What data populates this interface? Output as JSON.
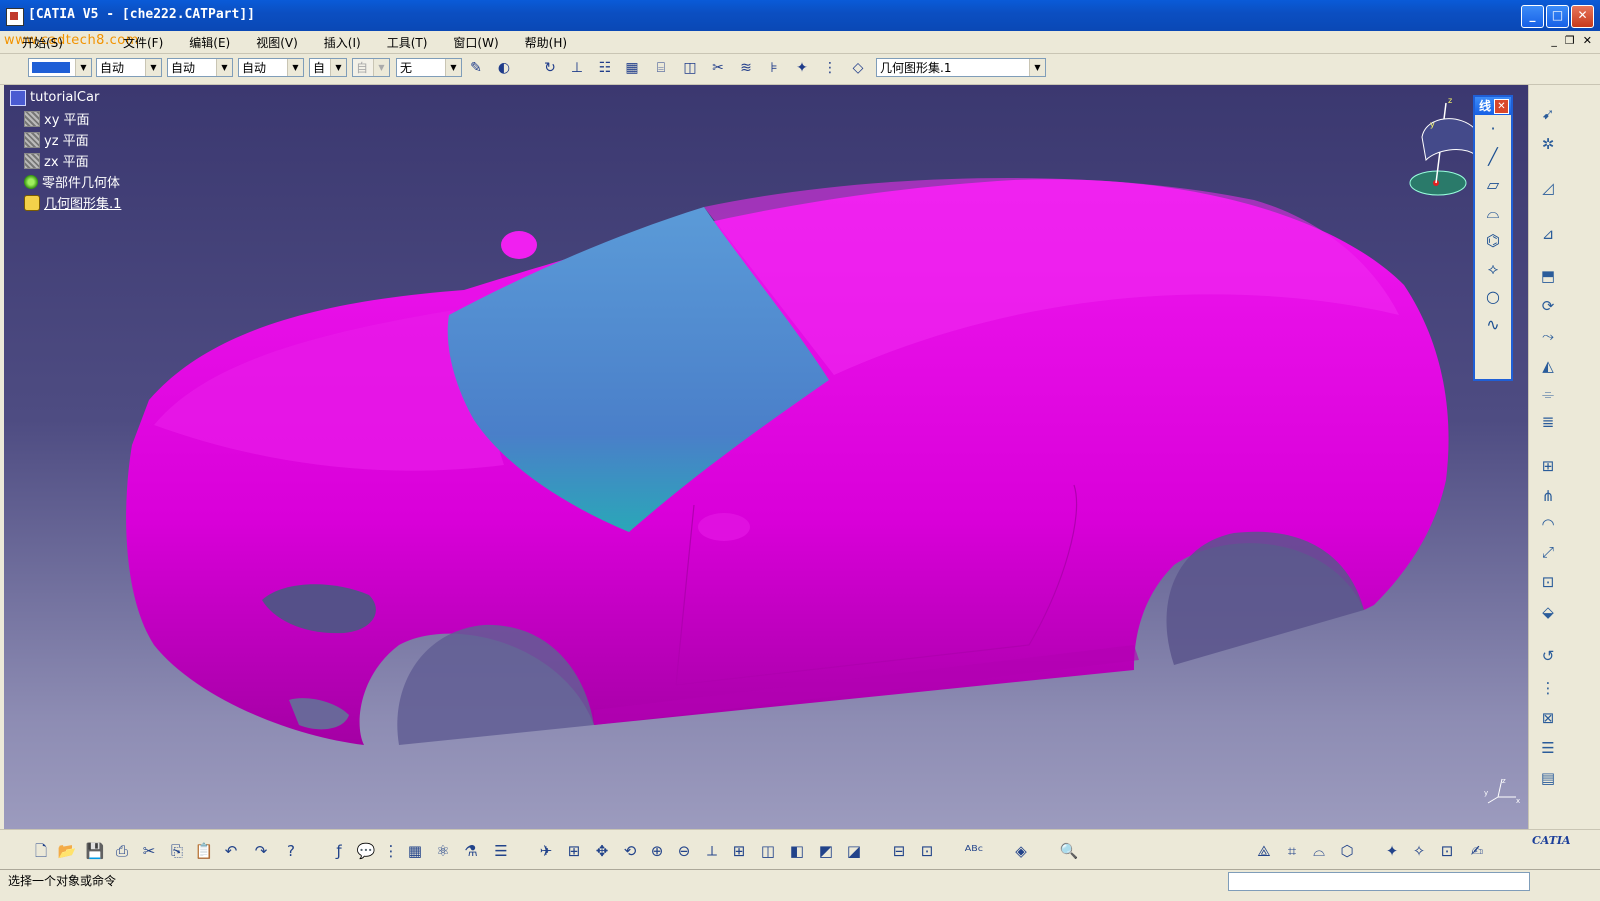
{
  "window": {
    "title": "[CATIA V5 - [che222.CATPart]]",
    "minimize": "_",
    "maximize": "□",
    "close": "✕"
  },
  "watermark": "www.cadtech8.com",
  "menu": [
    {
      "label": "开始(S)"
    },
    {
      "label": "文件(F)"
    },
    {
      "label": "编辑(E)"
    },
    {
      "label": "视图(V)"
    },
    {
      "label": "插入(I)"
    },
    {
      "label": "工具(T)"
    },
    {
      "label": "窗口(W)"
    },
    {
      "label": "帮助(H)"
    }
  ],
  "mdi": {
    "minimize": "_",
    "restore": "❐",
    "close": "✕"
  },
  "toolbar": {
    "combo_linetype": "自动",
    "combo_thickness": "自动",
    "combo_layer": "自动",
    "combo_4": "自",
    "combo_5": "自",
    "combo_layer_none": "无",
    "geo_set": "几何图形集.1"
  },
  "colors": {
    "car_body": "#e000e0",
    "glass": "#4e8fd0",
    "viewport_top": "#3b3870",
    "viewport_bottom": "#9c9bbe"
  },
  "tree": {
    "root": "tutorialCar",
    "items": [
      {
        "label": "xy 平面",
        "icon": "plane-icon"
      },
      {
        "label": "yz 平面",
        "icon": "plane-icon"
      },
      {
        "label": "zx 平面",
        "icon": "plane-icon"
      },
      {
        "label": "零部件几何体",
        "icon": "part-body-icon"
      },
      {
        "label": "几何图形集.1",
        "icon": "geometrical-set-icon"
      }
    ]
  },
  "palette": {
    "title": "线"
  },
  "compass": {
    "x": "x",
    "y": "y",
    "z": "z"
  },
  "status": {
    "message": "选择一个对象或命令"
  },
  "brand": "CATIA"
}
